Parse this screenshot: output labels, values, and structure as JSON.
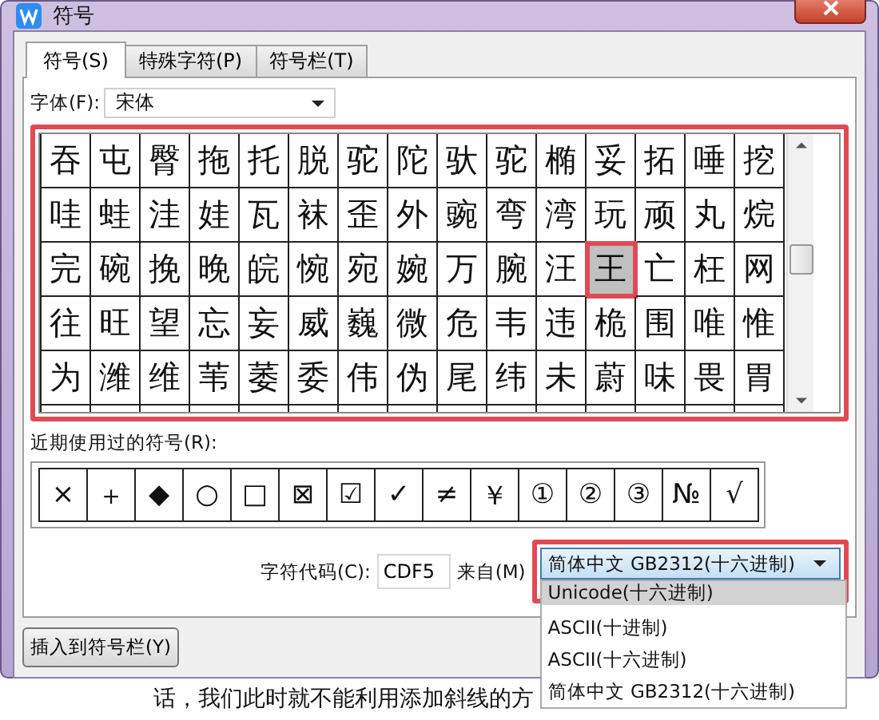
{
  "window": {
    "title": "符号"
  },
  "tabs": [
    {
      "label": "符号(S)",
      "selected": true
    },
    {
      "label": "特殊字符(P)",
      "selected": false
    },
    {
      "label": "符号栏(T)",
      "selected": false
    }
  ],
  "font": {
    "label": "字体(F):",
    "value": "宋体"
  },
  "grid": {
    "rows": [
      [
        {
          "c": "吞",
          "selected": false
        },
        {
          "c": "屯",
          "selected": false
        },
        {
          "c": "臀",
          "selected": false
        },
        {
          "c": "拖",
          "selected": false
        },
        {
          "c": "托",
          "selected": false
        },
        {
          "c": "脱",
          "selected": false
        },
        {
          "c": "驼",
          "selected": false
        },
        {
          "c": "陀",
          "selected": false
        },
        {
          "c": "驮",
          "selected": false
        },
        {
          "c": "驼",
          "selected": false
        },
        {
          "c": "椭",
          "selected": false
        },
        {
          "c": "妥",
          "selected": false
        },
        {
          "c": "拓",
          "selected": false
        },
        {
          "c": "唾",
          "selected": false
        },
        {
          "c": "挖",
          "selected": false
        }
      ],
      [
        {
          "c": "哇",
          "selected": false
        },
        {
          "c": "蛙",
          "selected": false
        },
        {
          "c": "洼",
          "selected": false
        },
        {
          "c": "娃",
          "selected": false
        },
        {
          "c": "瓦",
          "selected": false
        },
        {
          "c": "袜",
          "selected": false
        },
        {
          "c": "歪",
          "selected": false
        },
        {
          "c": "外",
          "selected": false
        },
        {
          "c": "豌",
          "selected": false
        },
        {
          "c": "弯",
          "selected": false
        },
        {
          "c": "湾",
          "selected": false
        },
        {
          "c": "玩",
          "selected": false
        },
        {
          "c": "顽",
          "selected": false
        },
        {
          "c": "丸",
          "selected": false
        },
        {
          "c": "烷",
          "selected": false
        }
      ],
      [
        {
          "c": "完",
          "selected": false
        },
        {
          "c": "碗",
          "selected": false
        },
        {
          "c": "挽",
          "selected": false
        },
        {
          "c": "晚",
          "selected": false
        },
        {
          "c": "皖",
          "selected": false
        },
        {
          "c": "惋",
          "selected": false
        },
        {
          "c": "宛",
          "selected": false
        },
        {
          "c": "婉",
          "selected": false
        },
        {
          "c": "万",
          "selected": false
        },
        {
          "c": "腕",
          "selected": false
        },
        {
          "c": "汪",
          "selected": false
        },
        {
          "c": "王",
          "selected": true
        },
        {
          "c": "亡",
          "selected": false
        },
        {
          "c": "枉",
          "selected": false
        },
        {
          "c": "网",
          "selected": false
        }
      ],
      [
        {
          "c": "往",
          "selected": false
        },
        {
          "c": "旺",
          "selected": false
        },
        {
          "c": "望",
          "selected": false
        },
        {
          "c": "忘",
          "selected": false
        },
        {
          "c": "妄",
          "selected": false
        },
        {
          "c": "威",
          "selected": false
        },
        {
          "c": "巍",
          "selected": false
        },
        {
          "c": "微",
          "selected": false
        },
        {
          "c": "危",
          "selected": false
        },
        {
          "c": "韦",
          "selected": false
        },
        {
          "c": "违",
          "selected": false
        },
        {
          "c": "桅",
          "selected": false
        },
        {
          "c": "围",
          "selected": false
        },
        {
          "c": "唯",
          "selected": false
        },
        {
          "c": "惟",
          "selected": false
        }
      ],
      [
        {
          "c": "为",
          "selected": false
        },
        {
          "c": "潍",
          "selected": false
        },
        {
          "c": "维",
          "selected": false
        },
        {
          "c": "苇",
          "selected": false
        },
        {
          "c": "萎",
          "selected": false
        },
        {
          "c": "委",
          "selected": false
        },
        {
          "c": "伟",
          "selected": false
        },
        {
          "c": "伪",
          "selected": false
        },
        {
          "c": "尾",
          "selected": false
        },
        {
          "c": "纬",
          "selected": false
        },
        {
          "c": "未",
          "selected": false
        },
        {
          "c": "蔚",
          "selected": false
        },
        {
          "c": "味",
          "selected": false
        },
        {
          "c": "畏",
          "selected": false
        },
        {
          "c": "胃",
          "selected": false
        }
      ]
    ]
  },
  "recent": {
    "label": "近期使用过的符号(R):",
    "symbols": [
      "×",
      "＋",
      "◆",
      "○",
      "□",
      "⊠",
      "☑",
      "✓",
      "≠",
      "￥",
      "①",
      "②",
      "③",
      "№",
      "√"
    ]
  },
  "code": {
    "label": "字符代码(C):",
    "value": "CDF5"
  },
  "source": {
    "label": "来自(M)",
    "value": "简体中文 GB2312(十六进制)",
    "options": [
      {
        "label": "Unicode(十六进制)",
        "highlighted": true
      },
      {
        "label": "ASCII(十进制)",
        "highlighted": false
      },
      {
        "label": "ASCII(十六进制)",
        "highlighted": false
      },
      {
        "label": "简体中文 GB2312(十六进制)",
        "highlighted": false
      }
    ]
  },
  "insert_button": "插入到符号栏(Y)",
  "document": {
    "text": "话，我们此时就不能利用添加斜线的方"
  }
}
